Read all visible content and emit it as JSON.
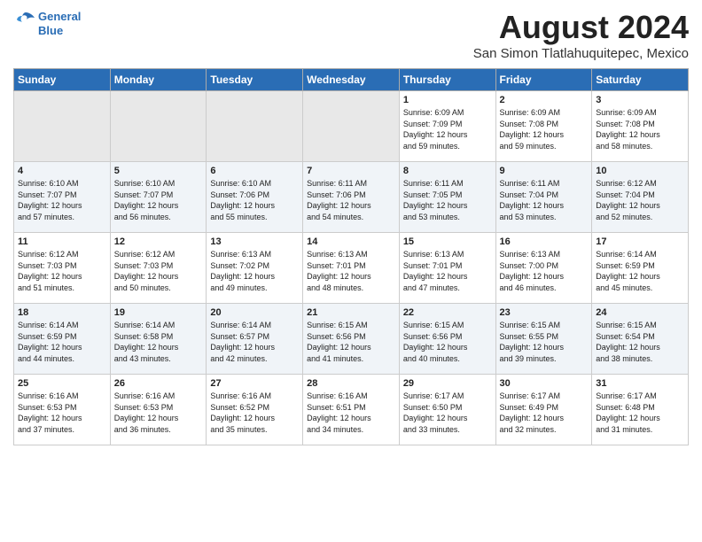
{
  "header": {
    "logo_line1": "General",
    "logo_line2": "Blue",
    "month_year": "August 2024",
    "location": "San Simon Tlatlahuquitepec, Mexico"
  },
  "days_of_week": [
    "Sunday",
    "Monday",
    "Tuesday",
    "Wednesday",
    "Thursday",
    "Friday",
    "Saturday"
  ],
  "weeks": [
    [
      {
        "day": "",
        "info": ""
      },
      {
        "day": "",
        "info": ""
      },
      {
        "day": "",
        "info": ""
      },
      {
        "day": "",
        "info": ""
      },
      {
        "day": "1",
        "info": "Sunrise: 6:09 AM\nSunset: 7:09 PM\nDaylight: 12 hours\nand 59 minutes."
      },
      {
        "day": "2",
        "info": "Sunrise: 6:09 AM\nSunset: 7:08 PM\nDaylight: 12 hours\nand 59 minutes."
      },
      {
        "day": "3",
        "info": "Sunrise: 6:09 AM\nSunset: 7:08 PM\nDaylight: 12 hours\nand 58 minutes."
      }
    ],
    [
      {
        "day": "4",
        "info": "Sunrise: 6:10 AM\nSunset: 7:07 PM\nDaylight: 12 hours\nand 57 minutes."
      },
      {
        "day": "5",
        "info": "Sunrise: 6:10 AM\nSunset: 7:07 PM\nDaylight: 12 hours\nand 56 minutes."
      },
      {
        "day": "6",
        "info": "Sunrise: 6:10 AM\nSunset: 7:06 PM\nDaylight: 12 hours\nand 55 minutes."
      },
      {
        "day": "7",
        "info": "Sunrise: 6:11 AM\nSunset: 7:06 PM\nDaylight: 12 hours\nand 54 minutes."
      },
      {
        "day": "8",
        "info": "Sunrise: 6:11 AM\nSunset: 7:05 PM\nDaylight: 12 hours\nand 53 minutes."
      },
      {
        "day": "9",
        "info": "Sunrise: 6:11 AM\nSunset: 7:04 PM\nDaylight: 12 hours\nand 53 minutes."
      },
      {
        "day": "10",
        "info": "Sunrise: 6:12 AM\nSunset: 7:04 PM\nDaylight: 12 hours\nand 52 minutes."
      }
    ],
    [
      {
        "day": "11",
        "info": "Sunrise: 6:12 AM\nSunset: 7:03 PM\nDaylight: 12 hours\nand 51 minutes."
      },
      {
        "day": "12",
        "info": "Sunrise: 6:12 AM\nSunset: 7:03 PM\nDaylight: 12 hours\nand 50 minutes."
      },
      {
        "day": "13",
        "info": "Sunrise: 6:13 AM\nSunset: 7:02 PM\nDaylight: 12 hours\nand 49 minutes."
      },
      {
        "day": "14",
        "info": "Sunrise: 6:13 AM\nSunset: 7:01 PM\nDaylight: 12 hours\nand 48 minutes."
      },
      {
        "day": "15",
        "info": "Sunrise: 6:13 AM\nSunset: 7:01 PM\nDaylight: 12 hours\nand 47 minutes."
      },
      {
        "day": "16",
        "info": "Sunrise: 6:13 AM\nSunset: 7:00 PM\nDaylight: 12 hours\nand 46 minutes."
      },
      {
        "day": "17",
        "info": "Sunrise: 6:14 AM\nSunset: 6:59 PM\nDaylight: 12 hours\nand 45 minutes."
      }
    ],
    [
      {
        "day": "18",
        "info": "Sunrise: 6:14 AM\nSunset: 6:59 PM\nDaylight: 12 hours\nand 44 minutes."
      },
      {
        "day": "19",
        "info": "Sunrise: 6:14 AM\nSunset: 6:58 PM\nDaylight: 12 hours\nand 43 minutes."
      },
      {
        "day": "20",
        "info": "Sunrise: 6:14 AM\nSunset: 6:57 PM\nDaylight: 12 hours\nand 42 minutes."
      },
      {
        "day": "21",
        "info": "Sunrise: 6:15 AM\nSunset: 6:56 PM\nDaylight: 12 hours\nand 41 minutes."
      },
      {
        "day": "22",
        "info": "Sunrise: 6:15 AM\nSunset: 6:56 PM\nDaylight: 12 hours\nand 40 minutes."
      },
      {
        "day": "23",
        "info": "Sunrise: 6:15 AM\nSunset: 6:55 PM\nDaylight: 12 hours\nand 39 minutes."
      },
      {
        "day": "24",
        "info": "Sunrise: 6:15 AM\nSunset: 6:54 PM\nDaylight: 12 hours\nand 38 minutes."
      }
    ],
    [
      {
        "day": "25",
        "info": "Sunrise: 6:16 AM\nSunset: 6:53 PM\nDaylight: 12 hours\nand 37 minutes."
      },
      {
        "day": "26",
        "info": "Sunrise: 6:16 AM\nSunset: 6:53 PM\nDaylight: 12 hours\nand 36 minutes."
      },
      {
        "day": "27",
        "info": "Sunrise: 6:16 AM\nSunset: 6:52 PM\nDaylight: 12 hours\nand 35 minutes."
      },
      {
        "day": "28",
        "info": "Sunrise: 6:16 AM\nSunset: 6:51 PM\nDaylight: 12 hours\nand 34 minutes."
      },
      {
        "day": "29",
        "info": "Sunrise: 6:17 AM\nSunset: 6:50 PM\nDaylight: 12 hours\nand 33 minutes."
      },
      {
        "day": "30",
        "info": "Sunrise: 6:17 AM\nSunset: 6:49 PM\nDaylight: 12 hours\nand 32 minutes."
      },
      {
        "day": "31",
        "info": "Sunrise: 6:17 AM\nSunset: 6:48 PM\nDaylight: 12 hours\nand 31 minutes."
      }
    ]
  ]
}
